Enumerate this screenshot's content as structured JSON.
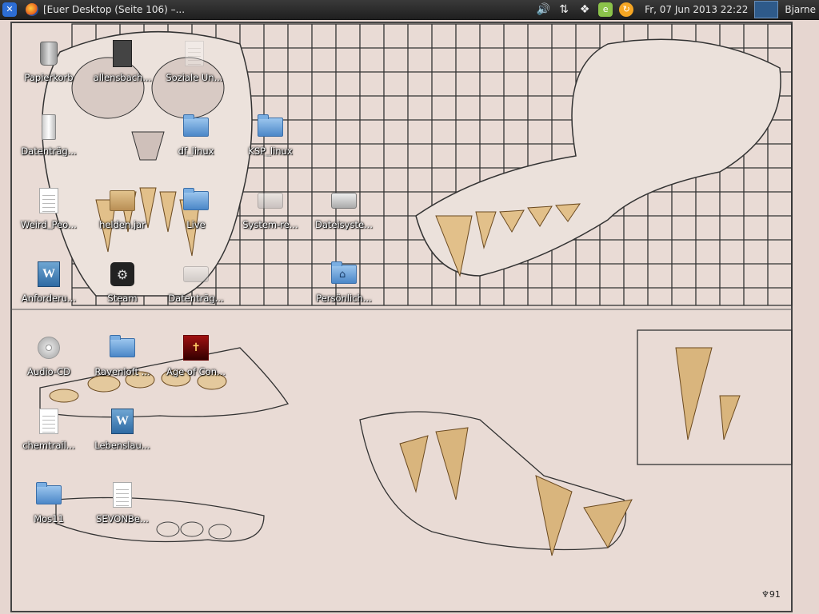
{
  "panel": {
    "menu_icon": "xubuntu-logo-icon",
    "task_title": "[Euer Desktop (Seite 106) –...",
    "tray_icons": [
      "volume-icon",
      "network-arrows-icon",
      "dropbox-icon",
      "evernote-icon",
      "update-notifier-icon"
    ],
    "clock": "Fr, 07 Jun 2013 22:22",
    "user": "Bjarne"
  },
  "desktop": {
    "icons": [
      {
        "label": "Papierkorb",
        "icon": "trash-icon"
      },
      {
        "label": "allensbach...",
        "icon": "book-icon"
      },
      {
        "label": "Soziale Un...",
        "icon": "document-icon"
      },
      {
        "label": "Datenträg...",
        "icon": "usb-drive-icon"
      },
      {
        "label": "df_linux",
        "icon": "folder-icon"
      },
      {
        "label": "KSP_linux",
        "icon": "folder-icon"
      },
      {
        "label": "Weird_Peo...",
        "icon": "document-icon"
      },
      {
        "label": "helden.jar",
        "icon": "archive-icon"
      },
      {
        "label": "Live",
        "icon": "folder-icon"
      },
      {
        "label": "System-re...",
        "icon": "drive-icon"
      },
      {
        "label": "Dateisyste...",
        "icon": "drive-icon"
      },
      {
        "label": "Anforderu...",
        "icon": "word-document-icon"
      },
      {
        "label": "Steam",
        "icon": "steam-icon"
      },
      {
        "label": "Datenträg...",
        "icon": "drive-icon"
      },
      {
        "label": "Persönlich...",
        "icon": "home-folder-icon"
      },
      {
        "label": "Audio-CD",
        "icon": "cd-icon"
      },
      {
        "label": "Ravenloft ...",
        "icon": "folder-icon"
      },
      {
        "label": "Age of Con...",
        "icon": "game-icon"
      },
      {
        "label": "chemtrail...",
        "icon": "document-icon"
      },
      {
        "label": "Lebenslau...",
        "icon": "word-document-icon"
      },
      {
        "label": "Mos11",
        "icon": "folder-icon"
      },
      {
        "label": "SEVONBe...",
        "icon": "document-icon"
      }
    ]
  },
  "wallpaper": {
    "signature": "wallpaper-signature-icon"
  }
}
